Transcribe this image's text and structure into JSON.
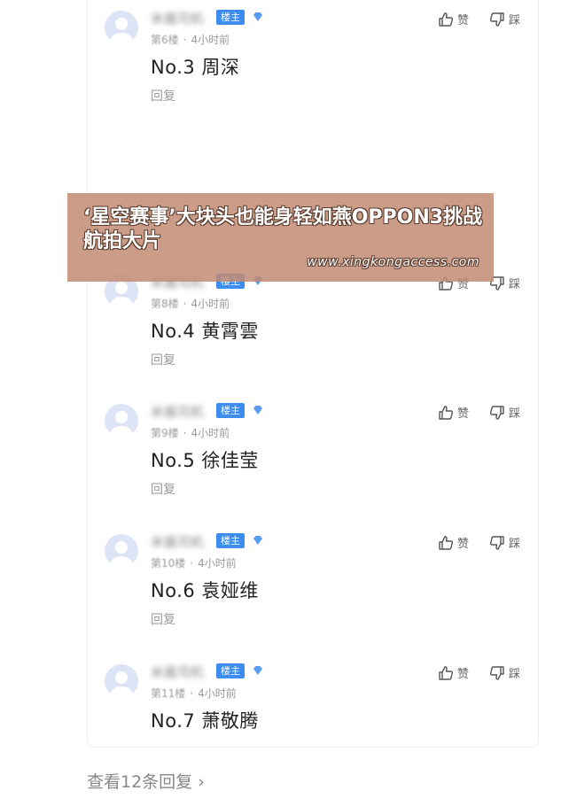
{
  "comments": [
    {
      "username": "米酱司机",
      "badge": "楼主",
      "floor": "第6楼",
      "time": "4小时前",
      "content": "No.3 周深",
      "reply": "回复",
      "like": "赞",
      "dislike": "踩"
    },
    {
      "username": "米酱司机",
      "badge": "楼主",
      "floor": "第8楼",
      "time": "4小时前",
      "content": "No.4 黄霄雲",
      "reply": "回复",
      "like": "赞",
      "dislike": "踩"
    },
    {
      "username": "米酱司机",
      "badge": "楼主",
      "floor": "第9楼",
      "time": "4小时前",
      "content": "No.5 徐佳莹",
      "reply": "回复",
      "like": "赞",
      "dislike": "踩"
    },
    {
      "username": "米酱司机",
      "badge": "楼主",
      "floor": "第10楼",
      "time": "4小时前",
      "content": "No.6 袁娅维",
      "reply": "回复",
      "like": "赞",
      "dislike": "踩"
    },
    {
      "username": "米酱司机",
      "badge": "楼主",
      "floor": "第11楼",
      "time": "4小时前",
      "content": "No.7 萧敬腾",
      "like": "赞",
      "dislike": "踩"
    }
  ],
  "banner": {
    "title": "‘星空赛事’大块头也能身轻如燕OPPON3挑战航拍大片",
    "url": "www.xingkongaccess.com"
  },
  "view_replies": "查看12条回复 ›",
  "colors": {
    "badge": "#3d8cf0",
    "banner": "#c38c73",
    "meta": "#9a9a9a"
  }
}
